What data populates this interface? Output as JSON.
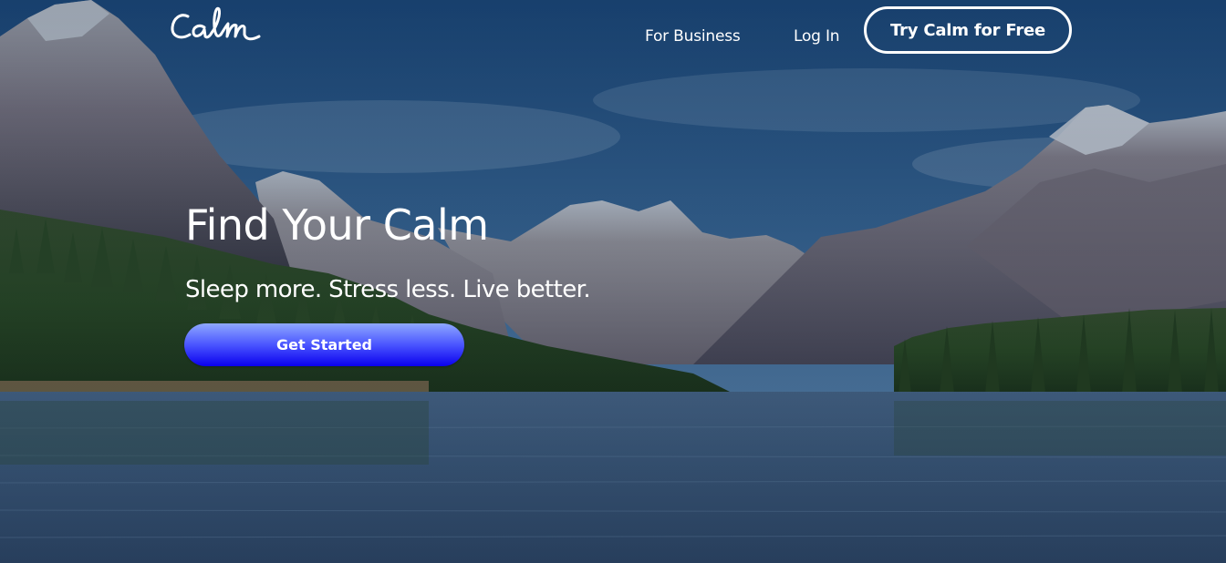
{
  "header": {
    "logo_text": "Calm",
    "nav": {
      "for_business": "For Business",
      "log_in": "Log In",
      "try_free": "Try Calm for Free"
    }
  },
  "hero": {
    "headline": "Find Your Calm",
    "subheadline": "Sleep more. Stress less. Live better.",
    "cta": "Get Started",
    "background": "mountain-lake-landscape"
  },
  "colors": {
    "cta_gradient_top": "#8ea8ff",
    "cta_gradient_bottom": "#0a00ee",
    "text": "#ffffff"
  }
}
